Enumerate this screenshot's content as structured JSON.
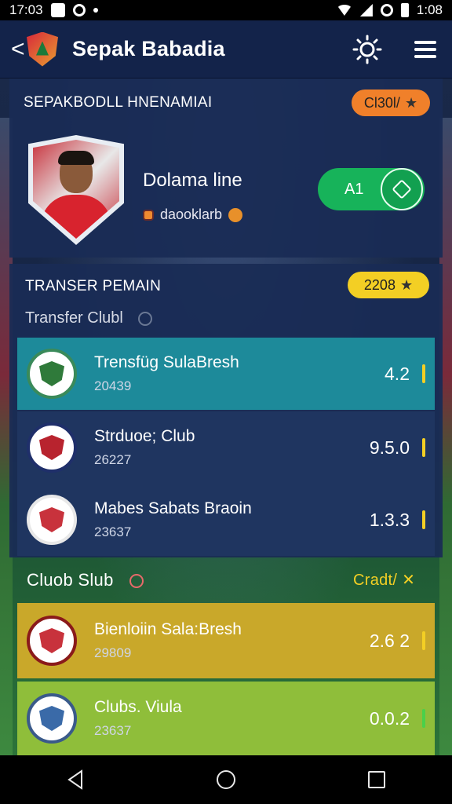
{
  "status_bar": {
    "time": "17:03",
    "clock_right": "1:08",
    "icons": [
      "notification-icon",
      "settings-ring-icon",
      "dot-icon",
      "wifi-icon",
      "signal-icon",
      "data-icon",
      "battery-icon"
    ]
  },
  "header": {
    "back": "<",
    "title": "Sepak Babadia",
    "icons": [
      "back-icon",
      "club-logo",
      "sun-icon",
      "menu-icon"
    ]
  },
  "profile_section": {
    "title": "SEPAKBODLL HNENAMIAI",
    "badge_label": "Cl30l/",
    "badge_color": "#f0802a",
    "player_name": "Dolama line",
    "player_handle": "daooklarb",
    "toggle_label": "A1",
    "toggle_color": "#17b35a"
  },
  "transfer_section": {
    "title": "TRANSER PEMAIN",
    "badge_label": "2208",
    "badge_color": "#f3cf24",
    "sub_label": "Transfer Clubl",
    "clubs": [
      {
        "name": "Trensfüg SulaBresh",
        "code": "20439",
        "score": "4.2",
        "bg": "#1d8a9a"
      },
      {
        "name": "Strduoe; Club",
        "code": "26227",
        "score": "9.5.0",
        "bg": "#1f3560"
      },
      {
        "name": "Mabes Sabats Braoin",
        "code": "23637",
        "score": "1.3.3",
        "bg": "#1f3560"
      }
    ]
  },
  "club_section": {
    "title": "Cluob Slub",
    "action_label": "Cradt/",
    "clubs": [
      {
        "name": "Bienloiin Sala:Bresh",
        "code": "29809",
        "score": "2.6 2",
        "bg": "#c9a82a"
      },
      {
        "name": "Clubs. Viula",
        "code": "23637",
        "score": "0.0.2",
        "bg": "#8fbe3a"
      }
    ]
  },
  "nav": {
    "icons": [
      "nav-back-icon",
      "nav-home-icon",
      "nav-recent-icon"
    ]
  }
}
